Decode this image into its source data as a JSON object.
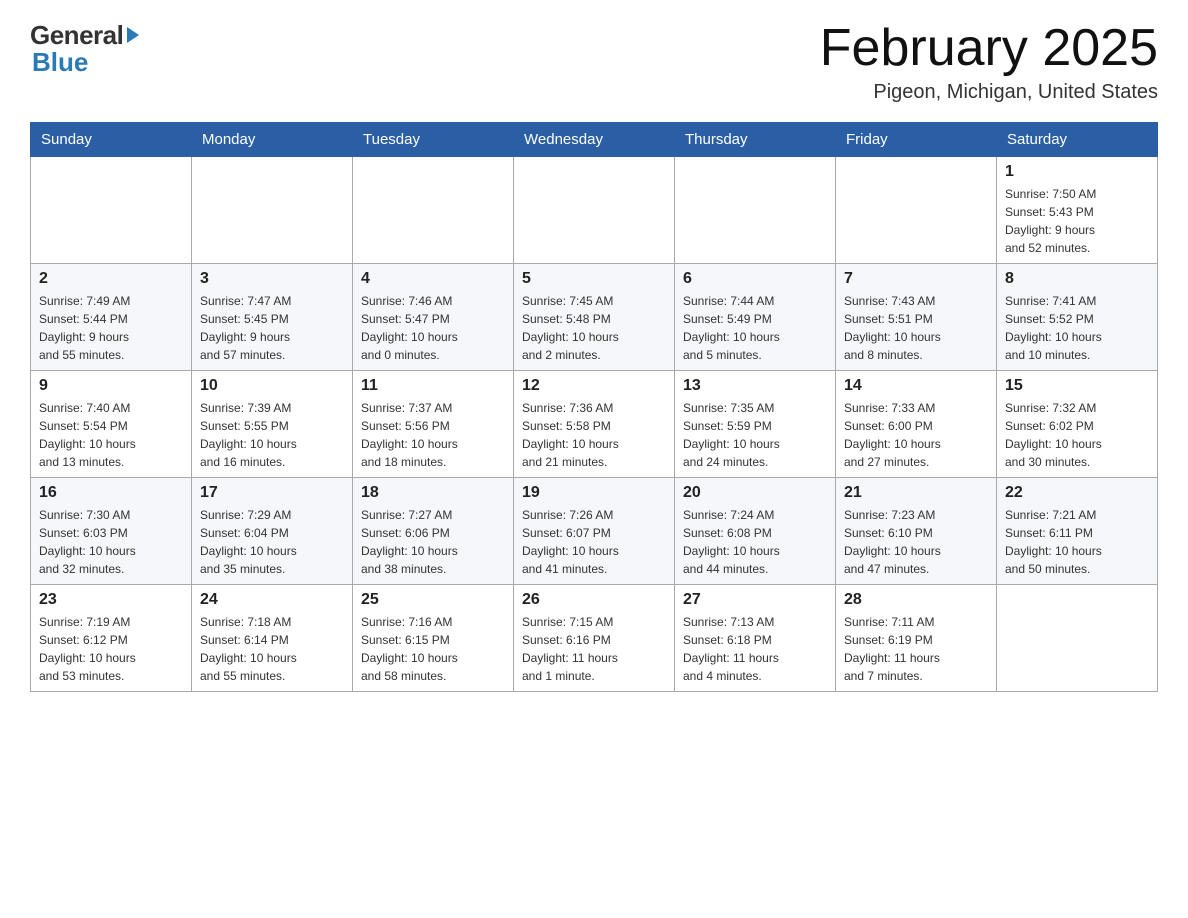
{
  "header": {
    "logo_general": "General",
    "logo_blue": "Blue",
    "month_title": "February 2025",
    "location": "Pigeon, Michigan, United States"
  },
  "days_of_week": [
    "Sunday",
    "Monday",
    "Tuesday",
    "Wednesday",
    "Thursday",
    "Friday",
    "Saturday"
  ],
  "weeks": [
    {
      "days": [
        {
          "number": "",
          "info": ""
        },
        {
          "number": "",
          "info": ""
        },
        {
          "number": "",
          "info": ""
        },
        {
          "number": "",
          "info": ""
        },
        {
          "number": "",
          "info": ""
        },
        {
          "number": "",
          "info": ""
        },
        {
          "number": "1",
          "info": "Sunrise: 7:50 AM\nSunset: 5:43 PM\nDaylight: 9 hours\nand 52 minutes."
        }
      ]
    },
    {
      "days": [
        {
          "number": "2",
          "info": "Sunrise: 7:49 AM\nSunset: 5:44 PM\nDaylight: 9 hours\nand 55 minutes."
        },
        {
          "number": "3",
          "info": "Sunrise: 7:47 AM\nSunset: 5:45 PM\nDaylight: 9 hours\nand 57 minutes."
        },
        {
          "number": "4",
          "info": "Sunrise: 7:46 AM\nSunset: 5:47 PM\nDaylight: 10 hours\nand 0 minutes."
        },
        {
          "number": "5",
          "info": "Sunrise: 7:45 AM\nSunset: 5:48 PM\nDaylight: 10 hours\nand 2 minutes."
        },
        {
          "number": "6",
          "info": "Sunrise: 7:44 AM\nSunset: 5:49 PM\nDaylight: 10 hours\nand 5 minutes."
        },
        {
          "number": "7",
          "info": "Sunrise: 7:43 AM\nSunset: 5:51 PM\nDaylight: 10 hours\nand 8 minutes."
        },
        {
          "number": "8",
          "info": "Sunrise: 7:41 AM\nSunset: 5:52 PM\nDaylight: 10 hours\nand 10 minutes."
        }
      ]
    },
    {
      "days": [
        {
          "number": "9",
          "info": "Sunrise: 7:40 AM\nSunset: 5:54 PM\nDaylight: 10 hours\nand 13 minutes."
        },
        {
          "number": "10",
          "info": "Sunrise: 7:39 AM\nSunset: 5:55 PM\nDaylight: 10 hours\nand 16 minutes."
        },
        {
          "number": "11",
          "info": "Sunrise: 7:37 AM\nSunset: 5:56 PM\nDaylight: 10 hours\nand 18 minutes."
        },
        {
          "number": "12",
          "info": "Sunrise: 7:36 AM\nSunset: 5:58 PM\nDaylight: 10 hours\nand 21 minutes."
        },
        {
          "number": "13",
          "info": "Sunrise: 7:35 AM\nSunset: 5:59 PM\nDaylight: 10 hours\nand 24 minutes."
        },
        {
          "number": "14",
          "info": "Sunrise: 7:33 AM\nSunset: 6:00 PM\nDaylight: 10 hours\nand 27 minutes."
        },
        {
          "number": "15",
          "info": "Sunrise: 7:32 AM\nSunset: 6:02 PM\nDaylight: 10 hours\nand 30 minutes."
        }
      ]
    },
    {
      "days": [
        {
          "number": "16",
          "info": "Sunrise: 7:30 AM\nSunset: 6:03 PM\nDaylight: 10 hours\nand 32 minutes."
        },
        {
          "number": "17",
          "info": "Sunrise: 7:29 AM\nSunset: 6:04 PM\nDaylight: 10 hours\nand 35 minutes."
        },
        {
          "number": "18",
          "info": "Sunrise: 7:27 AM\nSunset: 6:06 PM\nDaylight: 10 hours\nand 38 minutes."
        },
        {
          "number": "19",
          "info": "Sunrise: 7:26 AM\nSunset: 6:07 PM\nDaylight: 10 hours\nand 41 minutes."
        },
        {
          "number": "20",
          "info": "Sunrise: 7:24 AM\nSunset: 6:08 PM\nDaylight: 10 hours\nand 44 minutes."
        },
        {
          "number": "21",
          "info": "Sunrise: 7:23 AM\nSunset: 6:10 PM\nDaylight: 10 hours\nand 47 minutes."
        },
        {
          "number": "22",
          "info": "Sunrise: 7:21 AM\nSunset: 6:11 PM\nDaylight: 10 hours\nand 50 minutes."
        }
      ]
    },
    {
      "days": [
        {
          "number": "23",
          "info": "Sunrise: 7:19 AM\nSunset: 6:12 PM\nDaylight: 10 hours\nand 53 minutes."
        },
        {
          "number": "24",
          "info": "Sunrise: 7:18 AM\nSunset: 6:14 PM\nDaylight: 10 hours\nand 55 minutes."
        },
        {
          "number": "25",
          "info": "Sunrise: 7:16 AM\nSunset: 6:15 PM\nDaylight: 10 hours\nand 58 minutes."
        },
        {
          "number": "26",
          "info": "Sunrise: 7:15 AM\nSunset: 6:16 PM\nDaylight: 11 hours\nand 1 minute."
        },
        {
          "number": "27",
          "info": "Sunrise: 7:13 AM\nSunset: 6:18 PM\nDaylight: 11 hours\nand 4 minutes."
        },
        {
          "number": "28",
          "info": "Sunrise: 7:11 AM\nSunset: 6:19 PM\nDaylight: 11 hours\nand 7 minutes."
        },
        {
          "number": "",
          "info": ""
        }
      ]
    }
  ]
}
